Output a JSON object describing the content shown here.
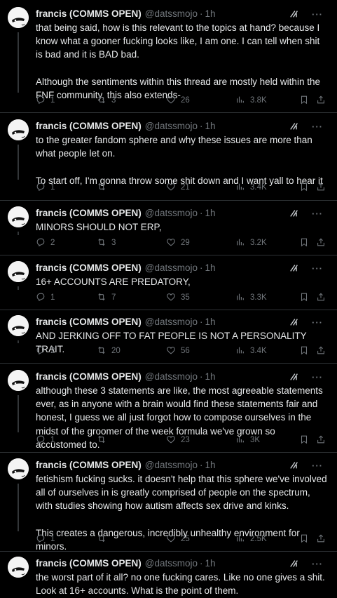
{
  "tweets": [
    {
      "author": {
        "name": "francis (COMMS OPEN)",
        "handle": "@datssmojo",
        "time": "1h"
      },
      "text": "that being said, how is this relevant to the topics at hand? because I know what a gooner fucking looks like, I am one. I can tell when shit is bad and it is BAD bad.\n\nAlthough the sentiments within this thread are mostly held within the FNF community, this also extends-",
      "stats": {
        "replies": "1",
        "reposts": "3",
        "likes": "26",
        "views": "3.8K"
      }
    },
    {
      "author": {
        "name": "francis (COMMS OPEN)",
        "handle": "@datssmojo",
        "time": "1h"
      },
      "text": "to the greater fandom sphere and why these issues are more than what people let on.\n\nTo start off, I'm gonna throw some shit down and I want yall to hear it",
      "stats": {
        "replies": "1",
        "reposts": "",
        "likes": "21",
        "views": "3.4K"
      }
    },
    {
      "author": {
        "name": "francis (COMMS OPEN)",
        "handle": "@datssmojo",
        "time": "1h"
      },
      "text": "MINORS SHOULD NOT ERP,",
      "stats": {
        "replies": "2",
        "reposts": "3",
        "likes": "29",
        "views": "3.2K"
      }
    },
    {
      "author": {
        "name": "francis (COMMS OPEN)",
        "handle": "@datssmojo",
        "time": "1h"
      },
      "text": "16+ ACCOUNTS ARE PREDATORY,",
      "stats": {
        "replies": "1",
        "reposts": "7",
        "likes": "35",
        "views": "3.3K"
      }
    },
    {
      "author": {
        "name": "francis (COMMS OPEN)",
        "handle": "@datssmojo",
        "time": "1h"
      },
      "text": "AND JERKING OFF TO FAT PEOPLE IS NOT A PERSONALITY TRAIT.",
      "stats": {
        "replies": "2",
        "reposts": "20",
        "likes": "56",
        "views": "3.4K"
      }
    },
    {
      "author": {
        "name": "francis (COMMS OPEN)",
        "handle": "@datssmojo",
        "time": "1h"
      },
      "text": "although these 3 statements are like, the most agreeable statements ever, as in anyone with a brain would find these statements fair and honest, I guess we all just forgot how to compose ourselves in the midst of the groomer of the week formula we've grown so accustomed to.",
      "stats": {
        "replies": "1",
        "reposts": "",
        "likes": "23",
        "views": "3K"
      }
    },
    {
      "author": {
        "name": "francis (COMMS OPEN)",
        "handle": "@datssmojo",
        "time": "1h"
      },
      "text": "fetishism fucking sucks. it doesn't help that this sphere we've involved all of ourselves in is greatly comprised of people on the spectrum, with studies showing how autism affects sex drive and kinks.\n\nThis creates a dangerous, incredibly unhealthy environment for minors.",
      "stats": {
        "replies": "1",
        "reposts": "",
        "likes": "25",
        "views": "2.5K"
      }
    },
    {
      "author": {
        "name": "francis (COMMS OPEN)",
        "handle": "@datssmojo",
        "time": "1h"
      },
      "text": "the worst part of it all? no one fucking cares. Like no one gives a shit. Look at 16+ accounts. What is the point of them.",
      "stats": {
        "replies": "",
        "reposts": "",
        "likes": "",
        "views": ""
      }
    }
  ]
}
